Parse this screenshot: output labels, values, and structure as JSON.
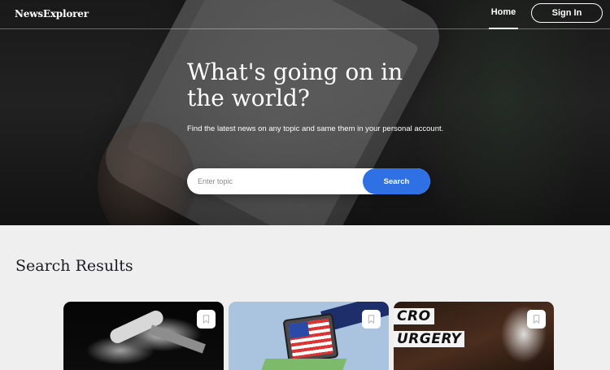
{
  "header": {
    "logo": "NewsExplorer",
    "nav_home": "Home",
    "sign_in": "Sign In"
  },
  "hero": {
    "title": "What's going on in the world?",
    "subtitle": "Find the latest news on any topic and same them in your personal account.",
    "search_placeholder": "Enter topic",
    "search_button": "Search"
  },
  "results": {
    "title": "Search Results",
    "cards": [
      {
        "image": "space-shuttle",
        "bookmark_icon": "bookmark-icon"
      },
      {
        "image": "briefcase-flag-illustration",
        "bookmark_icon": "bookmark-icon"
      },
      {
        "image": "micro-surgery-photo",
        "overlay_text_1": "CRO",
        "overlay_text_2": "URGERY",
        "bookmark_icon": "bookmark-icon"
      }
    ]
  },
  "colors": {
    "accent": "#2f71e5",
    "page_bg": "#efefef",
    "text_dark": "#1a1b22"
  }
}
